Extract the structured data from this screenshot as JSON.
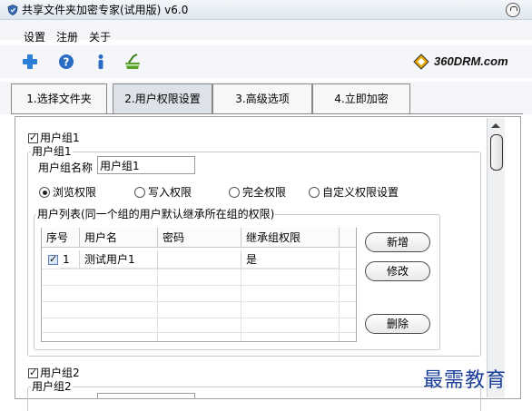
{
  "window": {
    "title": "共享文件夹加密专家(试用版) v6.0"
  },
  "menu": {
    "items": [
      "设置",
      "注册",
      "关于"
    ]
  },
  "toolbar": {
    "brand": "360DRM.com",
    "icons": [
      "add-icon",
      "help-icon",
      "info-icon",
      "cleanup-icon"
    ]
  },
  "tabs": [
    {
      "label": "1.选择文件夹",
      "active": false
    },
    {
      "label": "2.用户权限设置",
      "active": true
    },
    {
      "label": "3.高级选项",
      "active": false
    },
    {
      "label": "4.立即加密",
      "active": false
    }
  ],
  "group1": {
    "checkbox_label": "用户组1",
    "checked": true,
    "legend": "用户组1",
    "name_label": "用户组名称",
    "name_value": "用户组1",
    "permissions": [
      {
        "label": "浏览权限",
        "selected": true
      },
      {
        "label": "写入权限",
        "selected": false
      },
      {
        "label": "完全权限",
        "selected": false
      },
      {
        "label": "自定义权限设置",
        "selected": false
      }
    ],
    "user_list_legend": "用户列表(同一个组的用户默认继承所在组的权限)",
    "columns": [
      "序号",
      "用户名",
      "密码",
      "继承组权限"
    ],
    "rows": [
      {
        "checked": true,
        "no": "1",
        "username": "测试用户1",
        "password": "",
        "inherit": "是"
      }
    ],
    "buttons": {
      "add": "新增",
      "edit": "修改",
      "delete": "删除"
    }
  },
  "group2": {
    "checkbox_label": "用户组2",
    "checked": true,
    "legend": "用户组2"
  },
  "watermark": "最需教育",
  "colors": {
    "watermark": "#1c3f9a",
    "add_icon": "#2b7fd6",
    "help_icon": "#2a6cc4",
    "info_icon": "#2a6cc4",
    "cleanup_icon": "#5aa02c"
  }
}
